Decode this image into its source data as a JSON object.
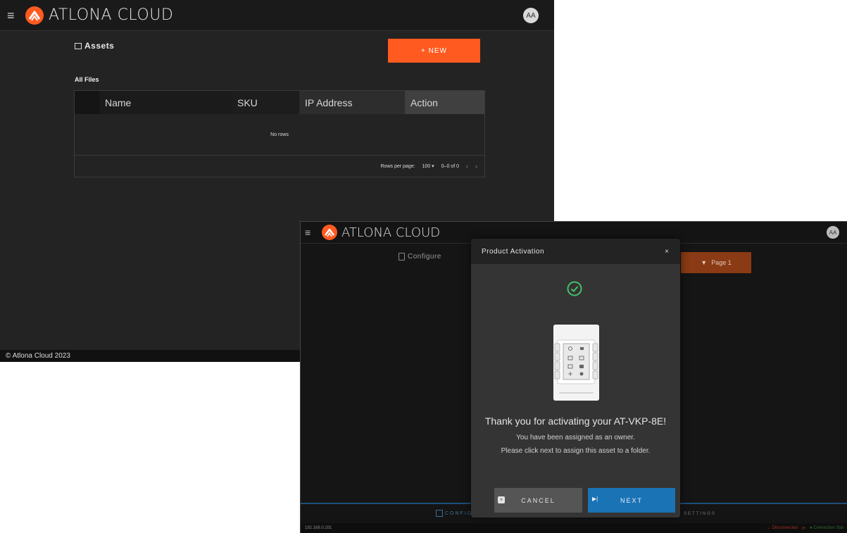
{
  "back_window": {
    "menu_icon": "hamburger-icon",
    "brand": "ATLONA CLOUD",
    "avatar": "AA",
    "page_title": "Assets",
    "new_button": "+ NEW",
    "section_title": "All Files",
    "table": {
      "columns": [
        "",
        "Name",
        "SKU",
        "IP Address",
        "Action"
      ],
      "empty_text": "No rows",
      "rows_per_page_label": "Rows per page:",
      "rows_per_page_value": "100",
      "range": "0–0 of 0",
      "prev": "‹",
      "next": "›"
    },
    "footer": "© Atlona Cloud 2023"
  },
  "front_window": {
    "brand": "ATLONA CLOUD",
    "avatar": "AA",
    "configure_label": "Configure",
    "page_button": "Page 1",
    "bottom_tab_config": "CONFIGU",
    "bottom_tab_settings": "SETTINGS",
    "ip": "192.168.0.201",
    "status_disconnected": "Disconnected",
    "status_connection": "Connection Stat"
  },
  "modal": {
    "title": "Product Activation",
    "close": "×",
    "heading": "Thank you for activating your AT-VKP-8E!",
    "line1": "You have been assigned as an owner.",
    "line2": "Please click next to assign this asset to a folder.",
    "cancel": "CANCEL",
    "next": "NEXT",
    "accent_success": "#43c26a",
    "accent_primary": "#1a73b5"
  }
}
